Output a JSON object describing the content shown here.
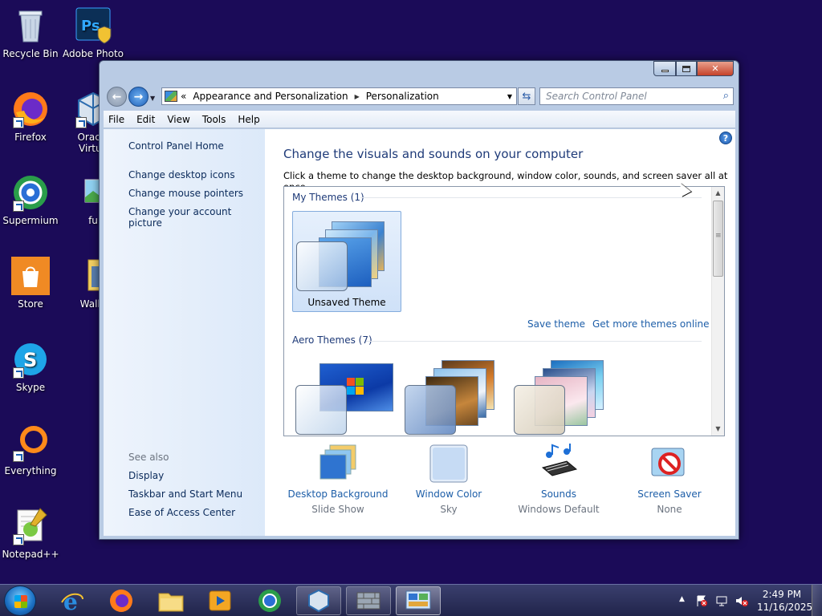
{
  "desktop": {
    "icons": [
      {
        "label": "Recycle Bin",
        "icon": "recycle-bin-icon"
      },
      {
        "label": "Adobe Photo",
        "icon": "photoshop-icon"
      },
      {
        "label": "Firefox",
        "icon": "firefox-icon"
      },
      {
        "label": "Oracle Virtua",
        "icon": "virtualbox-icon"
      },
      {
        "label": "Supermium",
        "icon": "supermium-icon"
      },
      {
        "label": "fu",
        "icon": "image-file-icon"
      },
      {
        "label": "Store",
        "icon": "store-icon"
      },
      {
        "label": "Wallp",
        "icon": "folder-icon"
      },
      {
        "label": "Skype",
        "icon": "skype-icon"
      },
      {
        "label": "Everything",
        "icon": "everything-search-icon"
      },
      {
        "label": "Notepad++",
        "icon": "notepadpp-icon"
      }
    ]
  },
  "window": {
    "address": {
      "overflow": "«",
      "segments": [
        "Appearance and Personalization",
        "Personalization"
      ]
    },
    "search": {
      "placeholder": "Search Control Panel"
    },
    "menu": [
      "File",
      "Edit",
      "View",
      "Tools",
      "Help"
    ],
    "left_pane": {
      "home": "Control Panel Home",
      "links": [
        "Change desktop icons",
        "Change mouse pointers",
        "Change your account picture"
      ],
      "see_also_label": "See also",
      "see_also": [
        "Display",
        "Taskbar and Start Menu",
        "Ease of Access Center"
      ]
    },
    "main": {
      "title": "Change the visuals and sounds on your computer",
      "description": "Click a theme to change the desktop background, window color, sounds, and screen saver all at once.",
      "my_themes_header": "My Themes (1)",
      "unsaved_theme": "Unsaved Theme",
      "save_theme": "Save theme",
      "get_more": "Get more themes online",
      "aero_themes_header": "Aero Themes (7)"
    },
    "bottom": [
      {
        "title": "Desktop Background",
        "value": "Slide Show",
        "icon": "desktop-background-icon"
      },
      {
        "title": "Window Color",
        "value": "Sky",
        "icon": "window-color-icon"
      },
      {
        "title": "Sounds",
        "value": "Windows Default",
        "icon": "sounds-icon"
      },
      {
        "title": "Screen Saver",
        "value": "None",
        "icon": "screen-saver-icon"
      }
    ]
  },
  "taskbar": {
    "pinned": [
      "internet-explorer-icon",
      "firefox-icon",
      "file-explorer-icon",
      "media-player-icon",
      "supermium-icon",
      "virtualbox-icon",
      "firewall-icon",
      "control-panel-icon"
    ],
    "clock_time": "2:49 PM",
    "clock_date": "11/16/2025"
  },
  "colors": {
    "desktop": "#1b0b58",
    "link": "#1d5ea8",
    "heading": "#1e3a78"
  }
}
